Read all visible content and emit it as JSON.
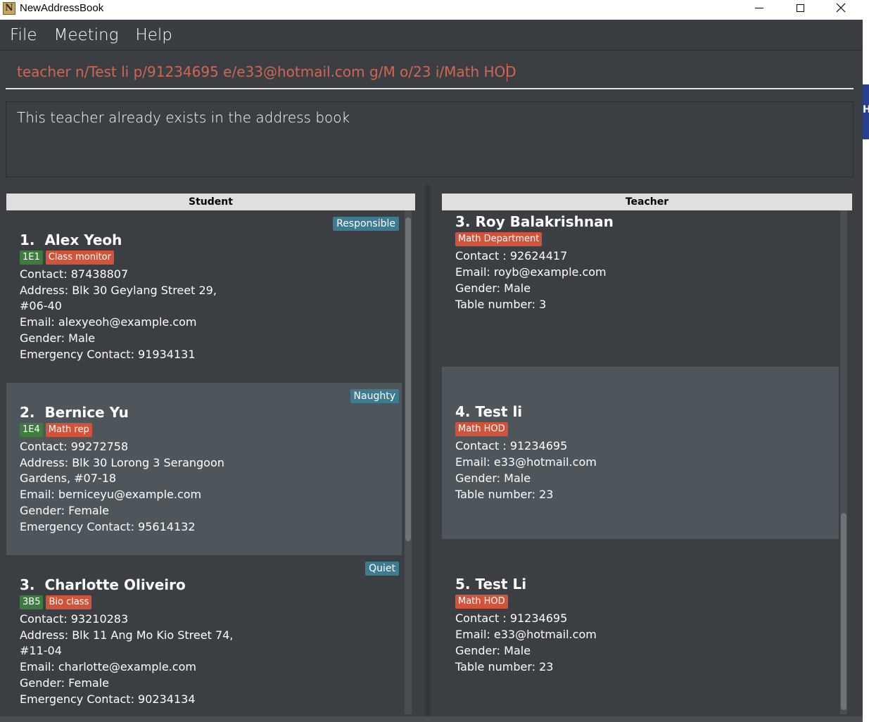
{
  "window": {
    "title": "NewAddressBook",
    "icon_letter": "N"
  },
  "menu": {
    "file": "File",
    "meeting": "Meeting",
    "help": "Help"
  },
  "command": {
    "value": "teacher n/Test li p/91234695 e/e33@hotmail.com g/M o/23 i/Math HOD"
  },
  "result": {
    "message": "This teacher already exists in the address book"
  },
  "edge": {
    "glyph": "H"
  },
  "students": {
    "header": "Student",
    "cards": [
      {
        "name": "1.  Alex Yeoh",
        "class_tag": "1E1",
        "role_tag": "Class monitor",
        "trait_tag": "Responsible",
        "contact": "Contact: 87438807",
        "address1": "Address: Blk 30 Geylang Street 29,",
        "address2": "#06-40",
        "email": "Email: alexyeoh@example.com",
        "gender": "Gender: Male",
        "emergency": "Emergency Contact: 91934131"
      },
      {
        "name": "2.  Bernice Yu",
        "class_tag": "1E4",
        "role_tag": "Math rep",
        "trait_tag": "Naughty",
        "contact": "Contact: 99272758",
        "address1": "Address: Blk 30 Lorong 3 Serangoon",
        "address2": "Gardens, #07-18",
        "email": "Email: berniceyu@example.com",
        "gender": "Gender: Female",
        "emergency": "Emergency Contact: 95614132"
      },
      {
        "name": "3.  Charlotte Oliveiro",
        "class_tag": "3B5",
        "role_tag": "Bio class",
        "trait_tag": "Quiet",
        "contact": "Contact: 93210283",
        "address1": "Address: Blk 11 Ang Mo Kio Street 74,",
        "address2": "#11-04",
        "email": "Email: charlotte@example.com",
        "gender": "Gender: Female",
        "emergency": "Emergency Contact: 90234134"
      }
    ]
  },
  "teachers": {
    "header": "Teacher",
    "cards": [
      {
        "name": "3. Roy Balakrishnan",
        "dept_tag": "Math Department",
        "contact": "Contact : 92624417",
        "email": "Email: royb@example.com",
        "gender": "Gender: Male",
        "table": "Table number: 3"
      },
      {
        "name": "4. Test li",
        "dept_tag": "Math HOD",
        "contact": "Contact : 91234695",
        "email": "Email: e33@hotmail.com",
        "gender": "Gender: Male",
        "table": "Table number: 23"
      },
      {
        "name": "5. Test Li",
        "dept_tag": "Math HOD",
        "contact": "Contact : 91234695",
        "email": "Email: e33@hotmail.com",
        "gender": "Gender: Male",
        "table": "Table number: 23"
      }
    ]
  }
}
